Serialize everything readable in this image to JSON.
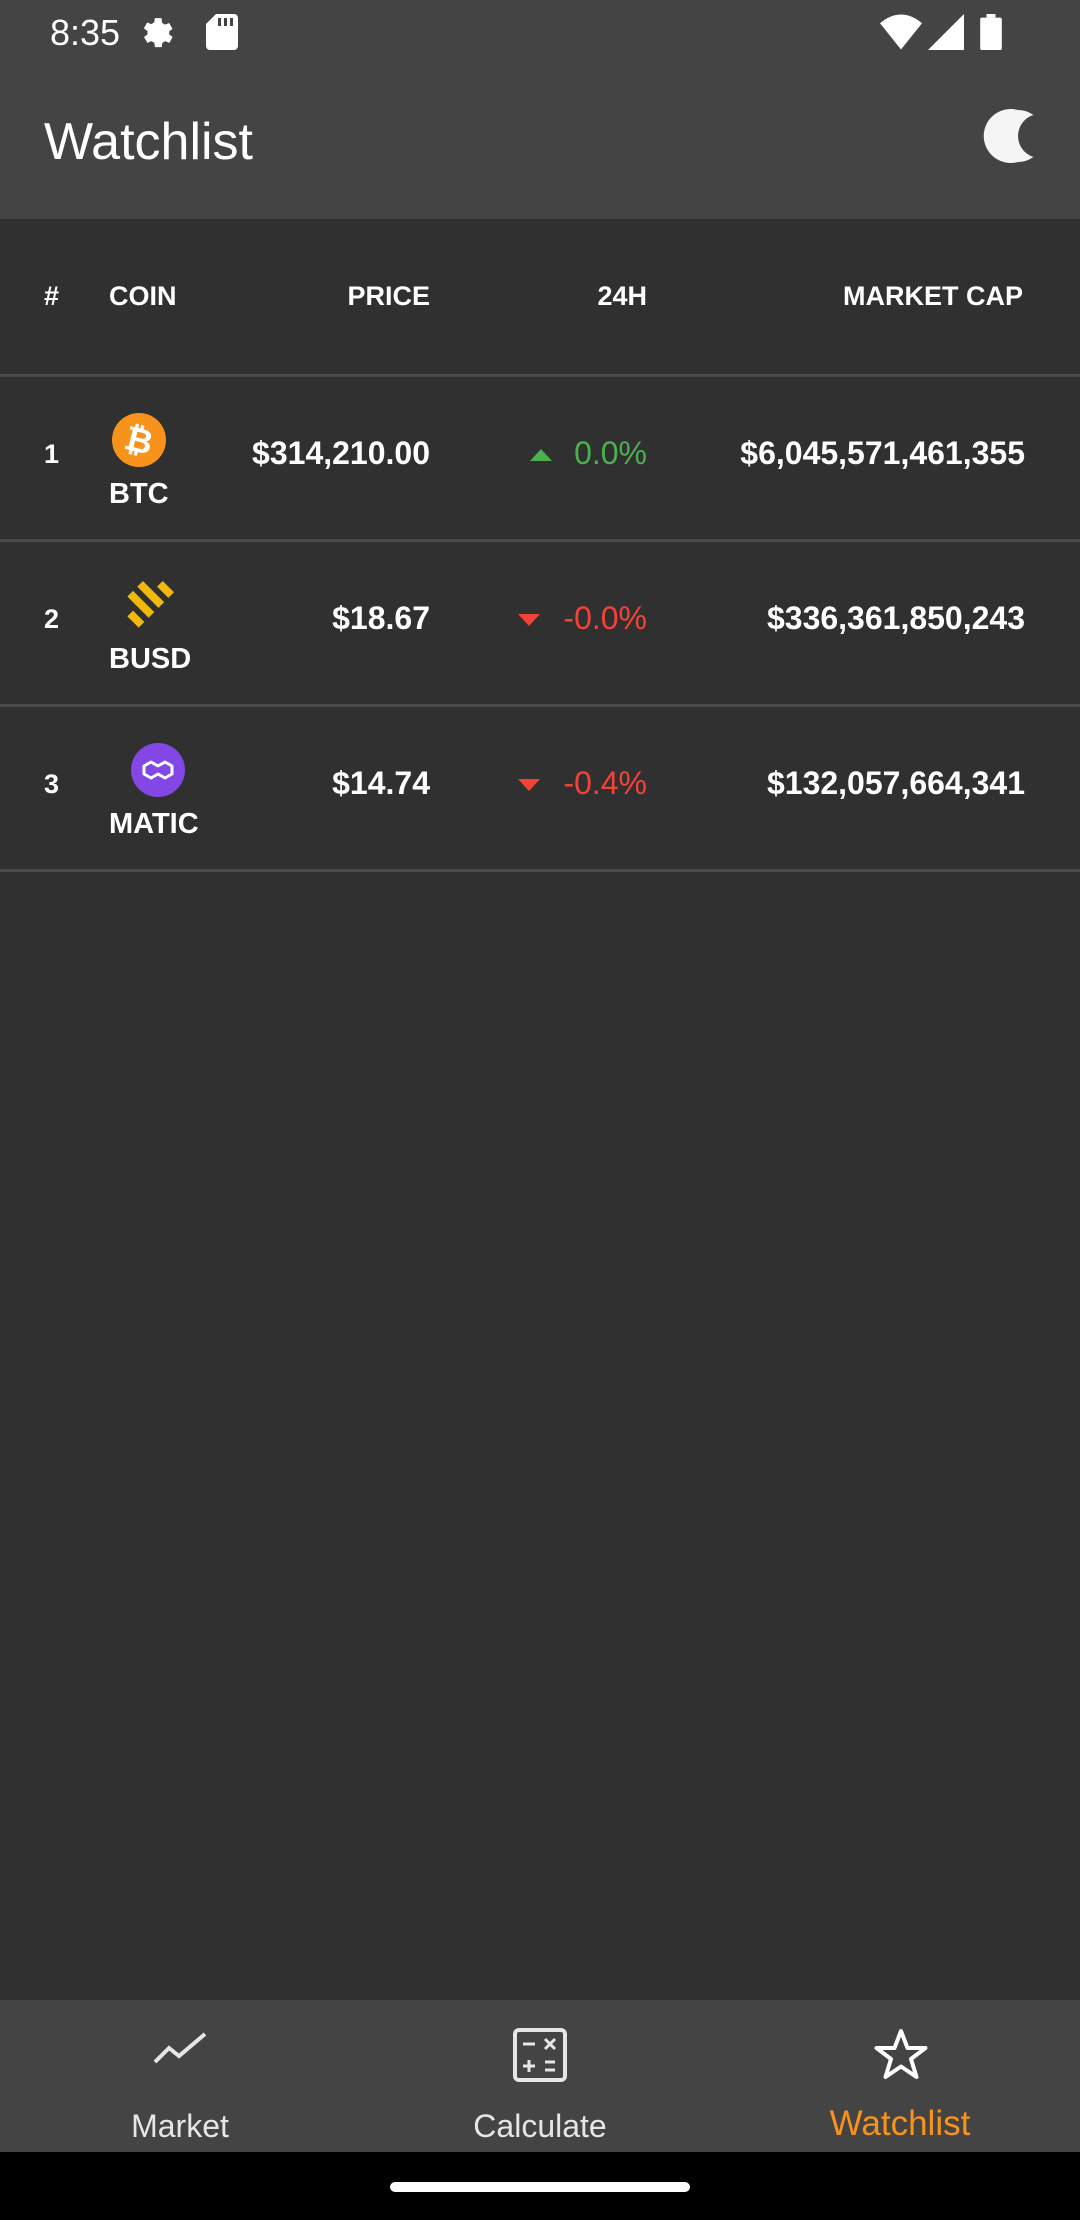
{
  "status_bar": {
    "time": "8:35",
    "icons": [
      "settings-icon",
      "sd-card-icon",
      "wifi-icon",
      "signal-icon",
      "battery-icon"
    ]
  },
  "app_bar": {
    "title": "Watchlist",
    "theme_icon": "moon-icon"
  },
  "table": {
    "headers": {
      "rank": "#",
      "coin": "COIN",
      "price": "PRICE",
      "change": "24H",
      "market_cap": "MARKET CAP"
    },
    "rows": [
      {
        "rank": "1",
        "symbol": "BTC",
        "icon": "bitcoin-icon",
        "icon_color": "#f7931a",
        "price": "$314,210.00",
        "change": "0.0%",
        "direction": "up",
        "market_cap": "$6,045,571,461,355"
      },
      {
        "rank": "2",
        "symbol": "BUSD",
        "icon": "busd-icon",
        "icon_color": "#f0b90b",
        "price": "$18.67",
        "change": "-0.0%",
        "direction": "down",
        "market_cap": "$336,361,850,243"
      },
      {
        "rank": "3",
        "symbol": "MATIC",
        "icon": "polygon-icon",
        "icon_color": "#8247e5",
        "price": "$14.74",
        "change": "-0.4%",
        "direction": "down",
        "market_cap": "$132,057,664,341"
      }
    ]
  },
  "colors": {
    "positive": "#4caf50",
    "negative": "#f44336",
    "accent": "#f7931a"
  },
  "bottom_nav": {
    "items": [
      {
        "label": "Market",
        "icon": "trending-icon",
        "active": false
      },
      {
        "label": "Calculate",
        "icon": "calculator-icon",
        "active": false
      },
      {
        "label": "Watchlist",
        "icon": "star-icon",
        "active": true
      }
    ]
  }
}
